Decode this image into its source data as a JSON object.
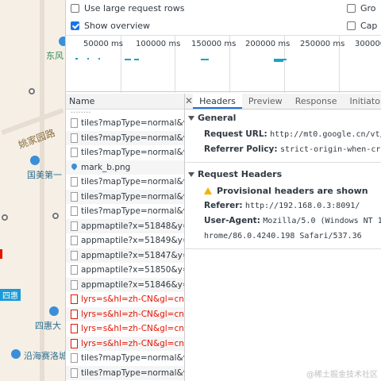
{
  "map": {
    "labels": [
      "东风",
      "姚家园路",
      "国美第一",
      "四惠",
      "四惠大",
      "沿海赛洛城"
    ]
  },
  "options": {
    "large_rows": {
      "label": "Use large request rows",
      "checked": false
    },
    "overview": {
      "label": "Show overview",
      "checked": true
    },
    "right1": "Gro",
    "right2": "Cap"
  },
  "timeline": {
    "ticks": [
      "50000 ms",
      "100000 ms",
      "150000 ms",
      "200000 ms",
      "250000 ms",
      "300000"
    ]
  },
  "name_panel": {
    "header": "Name",
    "rows": [
      {
        "text": "tiles?mapType=normal&v=",
        "type": "doc",
        "error": false
      },
      {
        "text": "tiles?mapType=normal&v=",
        "type": "doc",
        "error": false
      },
      {
        "text": "tiles?mapType=normal&v=",
        "type": "doc",
        "error": false
      },
      {
        "text": "mark_b.png",
        "type": "img",
        "error": false
      },
      {
        "text": "tiles?mapType=normal&v=",
        "type": "doc",
        "error": false
      },
      {
        "text": "tiles?mapType=normal&v=",
        "type": "doc",
        "error": false
      },
      {
        "text": "tiles?mapType=normal&v=",
        "type": "doc",
        "error": false
      },
      {
        "text": "appmaptile?x=51848&y=26",
        "type": "doc",
        "error": false
      },
      {
        "text": "appmaptile?x=51849&y=26",
        "type": "doc",
        "error": false
      },
      {
        "text": "appmaptile?x=51847&y=26",
        "type": "doc",
        "error": false
      },
      {
        "text": "appmaptile?x=51850&y=26",
        "type": "doc",
        "error": false
      },
      {
        "text": "appmaptile?x=51846&y=26",
        "type": "doc",
        "error": false
      },
      {
        "text": "lyrs=s&hl=zh-CN&gl=cn&x",
        "type": "doc",
        "error": true
      },
      {
        "text": "lyrs=s&hl=zh-CN&gl=cn&x",
        "type": "doc",
        "error": true
      },
      {
        "text": "lyrs=s&hl=zh-CN&gl=cn&x",
        "type": "doc",
        "error": true
      },
      {
        "text": "lyrs=s&hl=zh-CN&gl=cn&x",
        "type": "doc",
        "error": true
      },
      {
        "text": "tiles?mapType=normal&v=",
        "type": "doc",
        "error": false
      },
      {
        "text": "tiles?mapType=normal&v=",
        "type": "doc",
        "error": false
      },
      {
        "text": "tiles?mapType=normal&v=",
        "type": "doc",
        "error": false
      }
    ]
  },
  "details": {
    "tabs": [
      "Headers",
      "Preview",
      "Response",
      "Initiator"
    ],
    "general": {
      "title": "General",
      "request_url_key": "Request URL:",
      "request_url_val": "http://mt0.google.cn/vt/l",
      "referrer_policy_key": "Referrer Policy:",
      "referrer_policy_val": "strict-origin-when-cros"
    },
    "request_headers": {
      "title": "Request Headers",
      "warning": "Provisional headers are shown",
      "referer_key": "Referer:",
      "referer_val": "http://192.168.0.3:8091/",
      "ua_key": "User-Agent:",
      "ua_val": "Mozilla/5.0 (Windows NT 10",
      "ua_cont": "hrome/86.0.4240.198 Safari/537.36"
    }
  },
  "watermark": "@稀土掘金技术社区"
}
